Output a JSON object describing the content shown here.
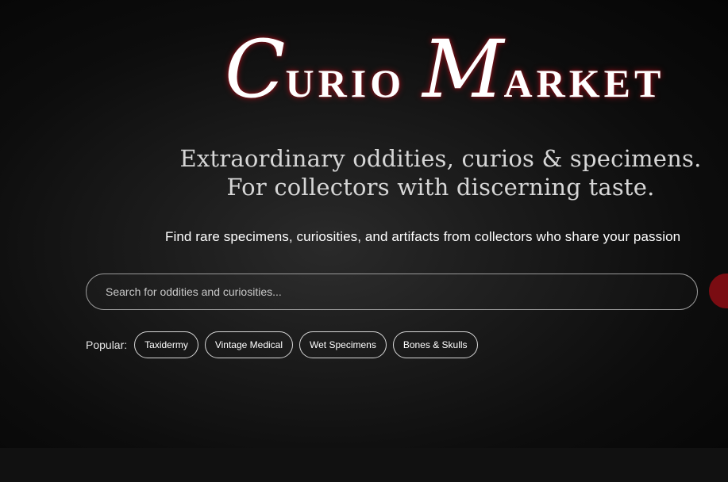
{
  "brand": {
    "word1_initial": "C",
    "word1_rest": "URIO",
    "word2_initial": "M",
    "word2_rest": "ARKET"
  },
  "hero": {
    "tagline_line1": "Extraordinary oddities, curios & specimens.",
    "tagline_line2": "For collectors with discerning taste.",
    "subtitle": "Find rare specimens, curiosities, and artifacts from collectors who share your passion"
  },
  "search": {
    "value": "",
    "placeholder": "Search for oddities and curiosities...",
    "button_color": "#7a0c12"
  },
  "popular": {
    "label": "Popular:",
    "tags": [
      "Taxidermy",
      "Vintage Medical",
      "Wet Specimens",
      "Bones & Skulls"
    ]
  },
  "colors": {
    "accent": "#7a0c12",
    "glow": "#aa141e",
    "background": "#0e0e0e"
  }
}
